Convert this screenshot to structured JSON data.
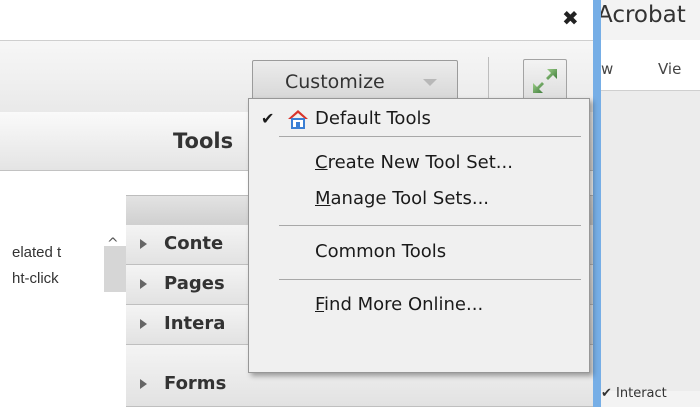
{
  "window": {
    "close_glyph": "✖"
  },
  "toolbar": {
    "customize_label": "Customize",
    "expand_icon": "expand-arrows-icon"
  },
  "tools_panel": {
    "title": "Tools",
    "info_lines": [
      "elated t",
      "ht-click"
    ],
    "sections": [
      "Conte",
      "Pages",
      "Intera",
      "Forms"
    ]
  },
  "acrobat": {
    "title": "Acrobat",
    "menu": [
      "w",
      "Vie"
    ],
    "bottom_item": "✔ Interact"
  },
  "menu": {
    "items": [
      {
        "label_pre": "",
        "label_u": "",
        "label_post": "Default Tools",
        "checked": true,
        "icon": "home-icon"
      },
      {
        "label_pre": "",
        "label_u": "C",
        "label_post": "reate New Tool Set..."
      },
      {
        "label_pre": "",
        "label_u": "M",
        "label_post": "anage Tool Sets..."
      },
      {
        "label_pre": "",
        "label_u": "",
        "label_post": "Common Tools"
      },
      {
        "label_pre": "",
        "label_u": "F",
        "label_post": "ind More Online..."
      }
    ],
    "check_glyph": "✔"
  },
  "colors": {
    "accent_blue": "#76aee6",
    "home_red": "#d9342b",
    "home_blue": "#3b7fd4"
  }
}
